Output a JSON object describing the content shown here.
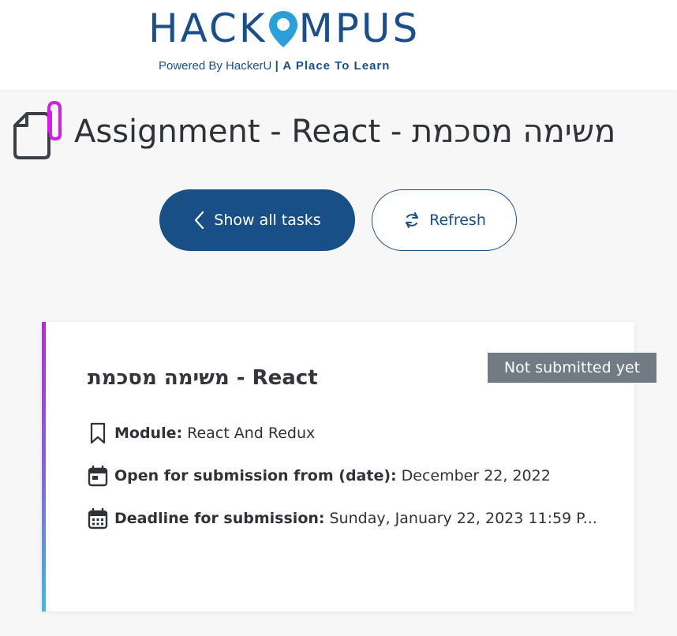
{
  "header": {
    "logo_title_left": "HACK",
    "logo_title_right": "MPUS",
    "logo_sub_left": "Powered By HackerU",
    "logo_sub_right": "| A Place To Learn"
  },
  "page": {
    "title": "Assignment - React - משימה מסכמת"
  },
  "buttons": {
    "show_all": "Show all tasks",
    "refresh": "Refresh"
  },
  "card": {
    "status_badge": "Not submitted yet",
    "title": "משימה מסכמת - React",
    "module_label": "Module:",
    "module_value": "React And Redux",
    "open_label": "Open for submission from (date):",
    "open_value": "December 22, 2022",
    "deadline_label": "Deadline for submission:",
    "deadline_value": "Sunday, January 22, 2023 11:59 P..."
  },
  "colors": {
    "brand": "#1a4f8b",
    "primary_button": "#174f86",
    "badge": "#727b83",
    "accent_pink": "#d21ee6",
    "accent_cyan": "#27c4f5"
  }
}
